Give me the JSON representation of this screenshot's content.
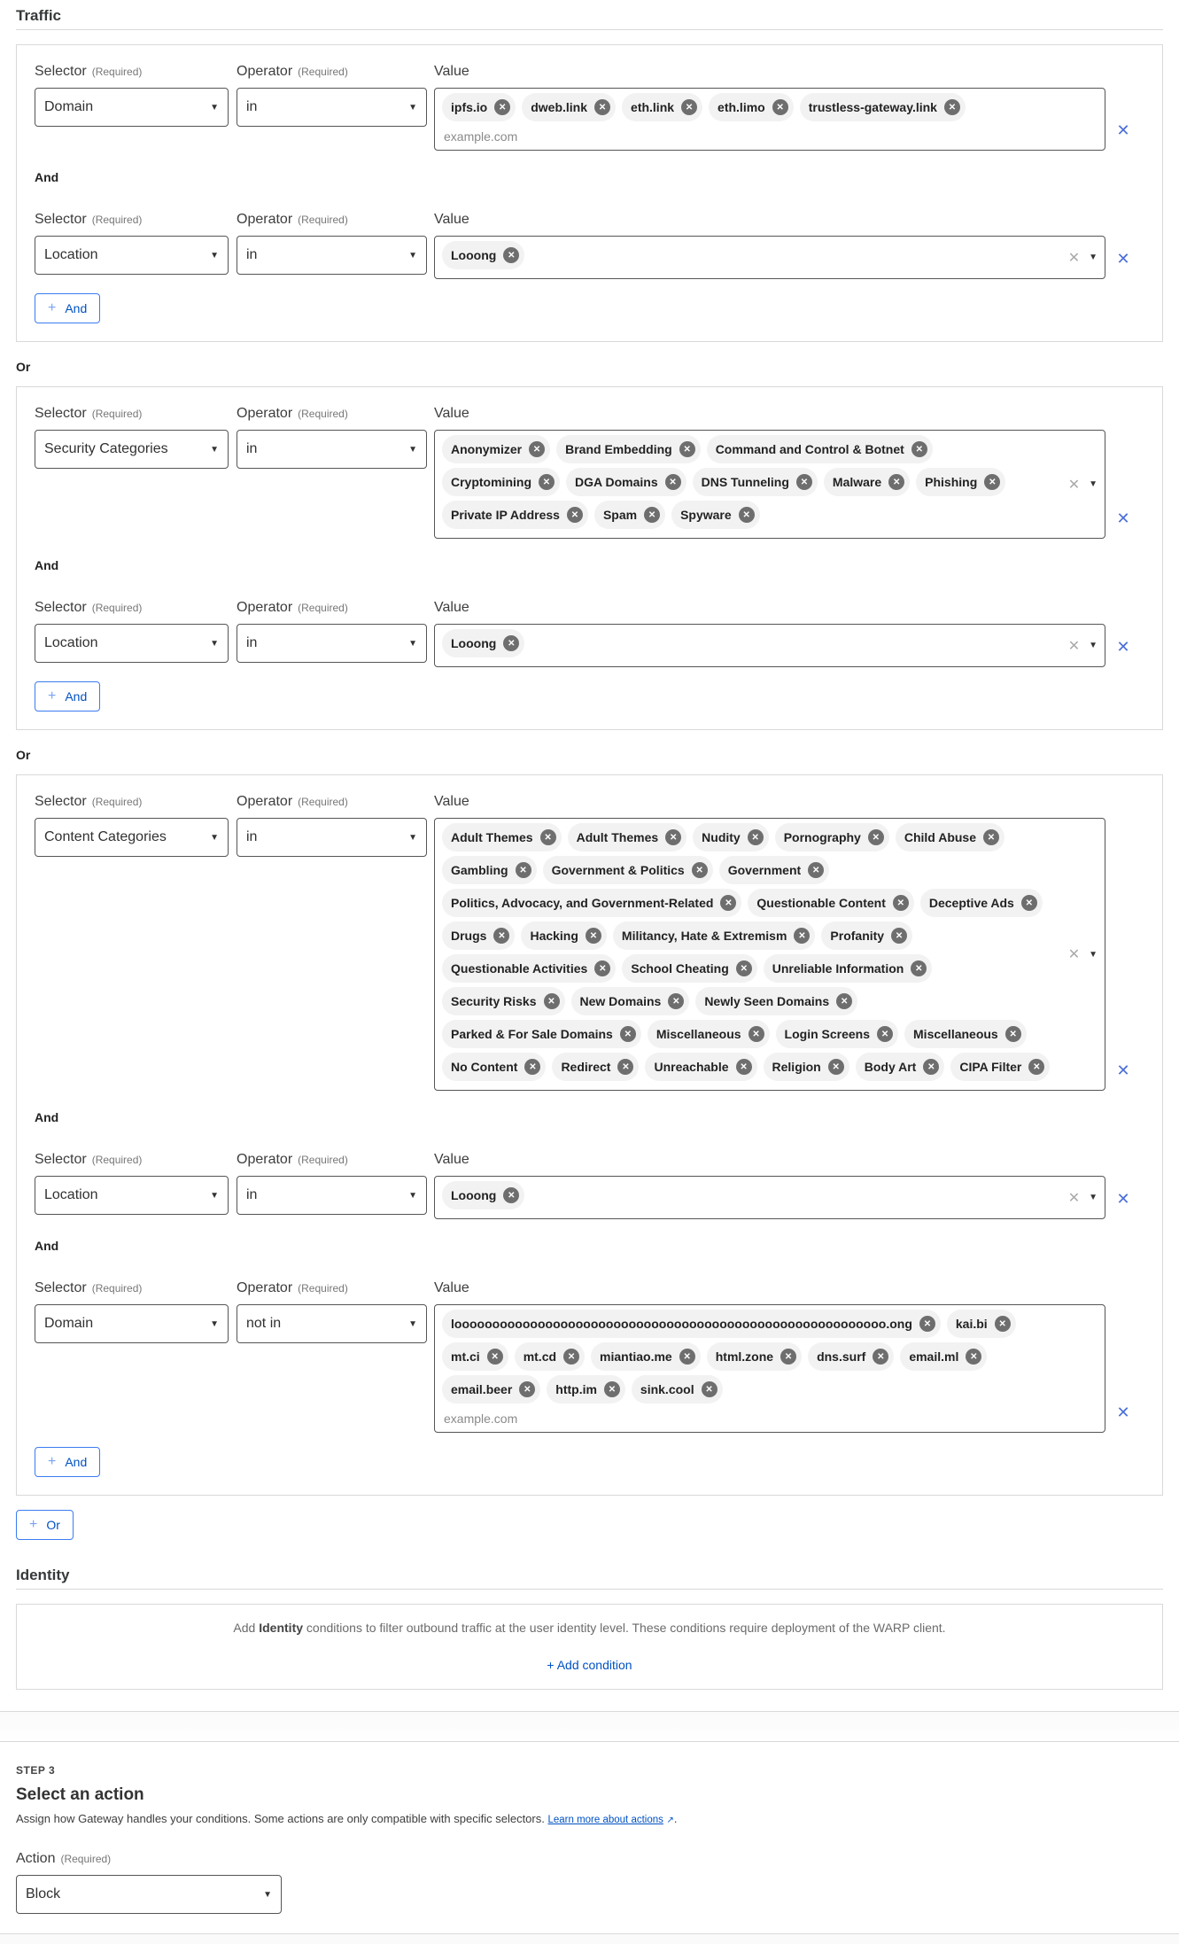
{
  "traffic": {
    "title": "Traffic",
    "or_label": "Or",
    "and_label": "And",
    "add_and_label": "And",
    "add_or_label": "Or",
    "selector_label": "Selector",
    "operator_label": "Operator",
    "value_label": "Value",
    "required_label": "(Required)",
    "groups": [
      {
        "conditions": [
          {
            "selector": "Domain",
            "operator": "in",
            "values": [
              "ipfs.io",
              "dweb.link",
              "eth.link",
              "eth.limo",
              "trustless-gateway.link"
            ],
            "placeholder": "example.com",
            "dropdown": false
          },
          {
            "selector": "Location",
            "operator": "in",
            "values": [
              "Looong"
            ],
            "dropdown": true
          }
        ]
      },
      {
        "conditions": [
          {
            "selector": "Security Categories",
            "operator": "in",
            "values": [
              "Anonymizer",
              "Brand Embedding",
              "Command and Control & Botnet",
              "Cryptomining",
              "DGA Domains",
              "DNS Tunneling",
              "Malware",
              "Phishing",
              "Private IP Address",
              "Spam",
              "Spyware"
            ],
            "dropdown": true
          },
          {
            "selector": "Location",
            "operator": "in",
            "values": [
              "Looong"
            ],
            "dropdown": true
          }
        ]
      },
      {
        "conditions": [
          {
            "selector": "Content Categories",
            "operator": "in",
            "values": [
              "Adult Themes",
              "Adult Themes",
              "Nudity",
              "Pornography",
              "Child Abuse",
              "Gambling",
              "Government & Politics",
              "Government",
              "Politics, Advocacy, and Government-Related",
              "Questionable Content",
              "Deceptive Ads",
              "Drugs",
              "Hacking",
              "Militancy, Hate & Extremism",
              "Profanity",
              "Questionable Activities",
              "School Cheating",
              "Unreliable Information",
              "Security Risks",
              "New Domains",
              "Newly Seen Domains",
              "Parked & For Sale Domains",
              "Miscellaneous",
              "Login Screens",
              "Miscellaneous",
              "No Content",
              "Redirect",
              "Unreachable",
              "Religion",
              "Body Art",
              "CIPA Filter"
            ],
            "dropdown": true
          },
          {
            "selector": "Location",
            "operator": "in",
            "values": [
              "Looong"
            ],
            "dropdown": true
          },
          {
            "selector": "Domain",
            "operator": "not in",
            "values": [
              "looooooooooooooooooooooooooooooooooooooooooooooooooooooooo.ong",
              "kai.bi",
              "mt.ci",
              "mt.cd",
              "miantiao.me",
              "html.zone",
              "dns.surf",
              "email.ml",
              "email.beer",
              "http.im",
              "sink.cool"
            ],
            "placeholder": "example.com",
            "dropdown": false
          }
        ]
      }
    ]
  },
  "identity": {
    "title": "Identity",
    "desc_pre": "Add ",
    "desc_bold": "Identity",
    "desc_post": " conditions to filter outbound traffic at the user identity level. These conditions require deployment of the WARP client.",
    "add_condition": "+ Add condition"
  },
  "step3": {
    "step": "STEP 3",
    "title": "Select an action",
    "desc": "Assign how Gateway handles your conditions. Some actions are only compatible with specific selectors. ",
    "link": "Learn more about actions",
    "link_icon": "external-link-icon",
    "action_label": "Action",
    "required_label": "(Required)",
    "action_value": "Block"
  },
  "colors": {
    "accent": "#0051c3",
    "chip_bg": "#f2f2f2",
    "chip_x": "#6e6e6e"
  }
}
